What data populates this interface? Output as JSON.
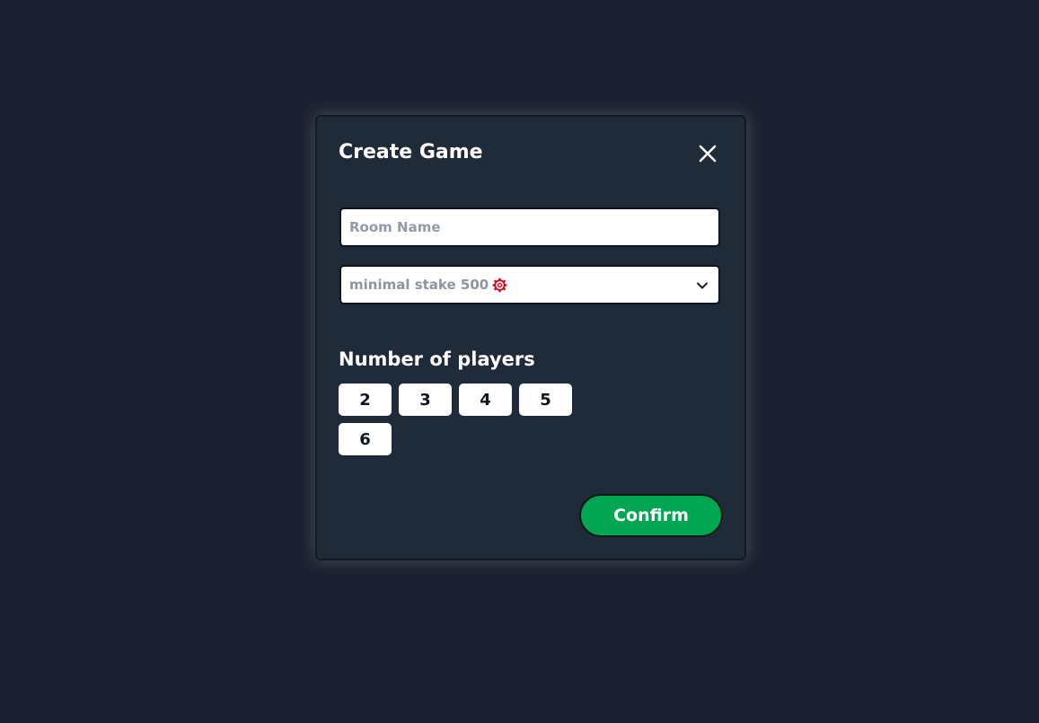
{
  "modal": {
    "title": "Create Game",
    "close_icon": "close-icon"
  },
  "room_name": {
    "value": "",
    "placeholder": "Room Name"
  },
  "stake_select": {
    "selected_label": "minimal stake 500",
    "currency_icon": "poker-chip-icon",
    "currency_icon_color": "#d0021b",
    "dropdown_icon": "chevron-down-icon"
  },
  "players": {
    "label": "Number of players",
    "options": [
      "2",
      "3",
      "4",
      "5",
      "6"
    ]
  },
  "confirm": {
    "label": "Confirm",
    "color": "#00a651"
  },
  "colors": {
    "page_background": "#1b2130",
    "modal_background": "#202b3a"
  }
}
